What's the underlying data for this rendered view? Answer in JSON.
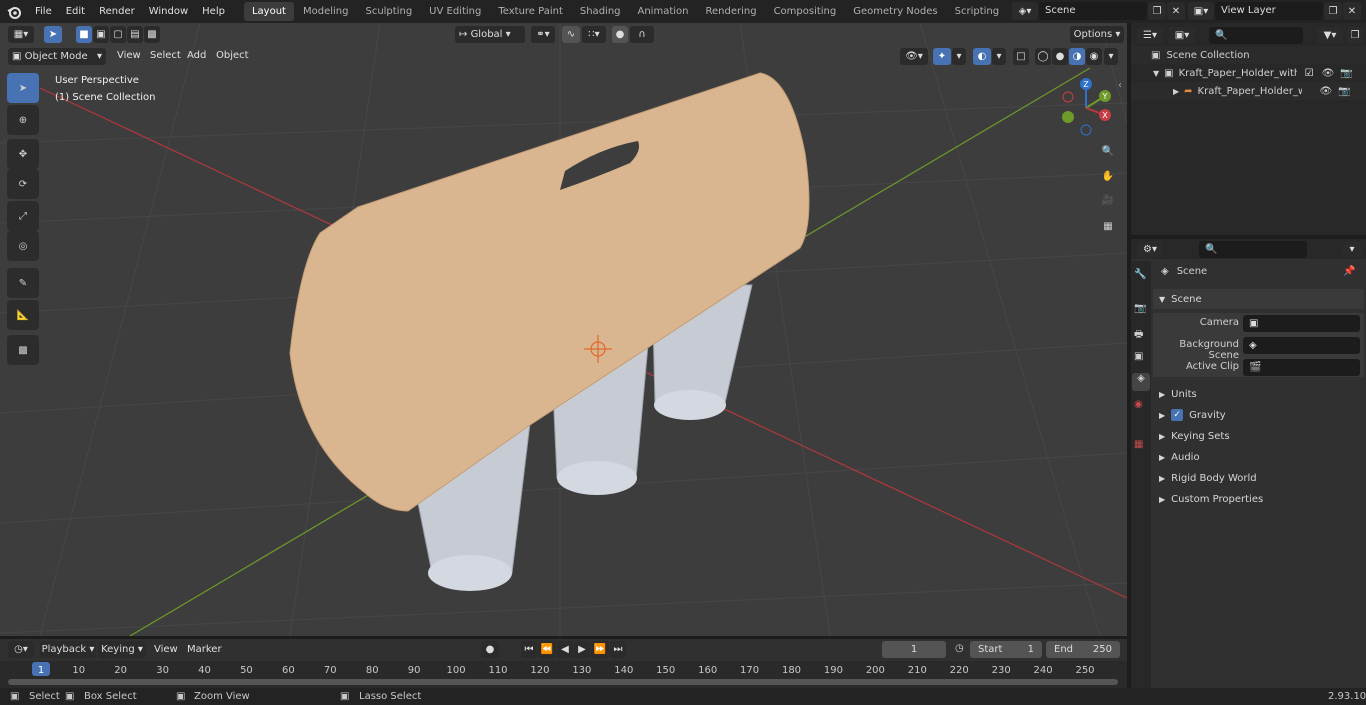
{
  "app": {
    "name": "Blender",
    "version": "2.93.10"
  },
  "menus": [
    "File",
    "Edit",
    "Render",
    "Window",
    "Help"
  ],
  "workspaces": [
    "Layout",
    "Modeling",
    "Sculpting",
    "UV Editing",
    "Texture Paint",
    "Shading",
    "Animation",
    "Rendering",
    "Compositing",
    "Geometry Nodes",
    "Scripting"
  ],
  "active_workspace": "Layout",
  "scene_name": "Scene",
  "view_layer": "View Layer",
  "viewport": {
    "mode": "Object Mode",
    "header_menus": [
      "View",
      "Select",
      "Add",
      "Object"
    ],
    "transform_orientation": "Global",
    "options_label": "Options",
    "perspective_label": "User Perspective",
    "collection_label": "(1) Scene Collection",
    "gizmo_axes": {
      "x": "X",
      "y": "Y",
      "z": "Z"
    }
  },
  "outliner": {
    "root": "Scene Collection",
    "items": [
      "Kraft_Paper_Holder_with_Thre",
      "Kraft_Paper_Holder_with_"
    ]
  },
  "properties": {
    "context_title": "Scene",
    "section": "Scene",
    "fields": [
      {
        "label": "Camera",
        "value": ""
      },
      {
        "label": "Background Scene",
        "value": ""
      },
      {
        "label": "Active Clip",
        "value": ""
      }
    ],
    "subsections": [
      "Units",
      "Gravity",
      "Keying Sets",
      "Audio",
      "Rigid Body World",
      "Custom Properties"
    ]
  },
  "timeline": {
    "menus": [
      "Playback",
      "Keying",
      "View",
      "Marker"
    ],
    "current_frame": "1",
    "start_label": "Start",
    "start": "1",
    "end_label": "End",
    "end": "250",
    "ticks": [
      "1",
      "10",
      "20",
      "30",
      "40",
      "50",
      "60",
      "70",
      "80",
      "90",
      "100",
      "110",
      "120",
      "130",
      "140",
      "150",
      "160",
      "170",
      "180",
      "190",
      "200",
      "210",
      "220",
      "230",
      "240",
      "250"
    ]
  },
  "statusbar": {
    "select": "Select",
    "box_select": "Box Select",
    "zoom_view": "Zoom View",
    "lasso_select": "Lasso Select"
  },
  "colors": {
    "accent": "#4772b3",
    "kraft": "#d9b590",
    "grid_bg": "#3d3d3d",
    "x_axis": "#b0383f",
    "y_axis": "#6e9a2a"
  }
}
